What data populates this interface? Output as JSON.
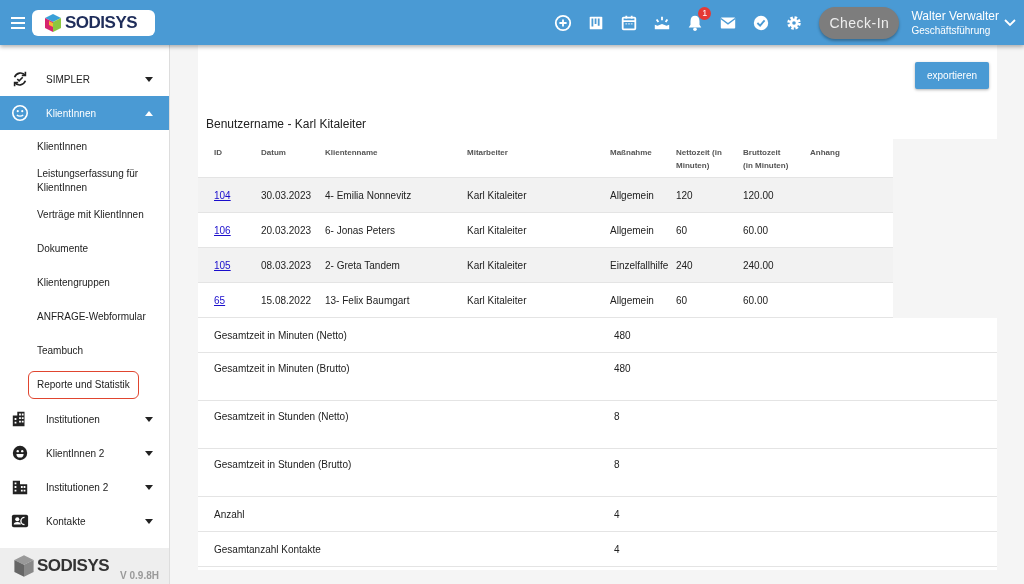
{
  "header": {
    "logo": "SODISYS",
    "notification_count": "1",
    "checkin_button": "Check-In",
    "user": {
      "name": "Walter Verwalter",
      "role": "Geschäftsführung"
    }
  },
  "sidebar": {
    "items": [
      {
        "label": "SIMPLER",
        "selected": false,
        "expanded": false
      },
      {
        "label": "KlientInnen",
        "selected": true,
        "expanded": true,
        "children": [
          {
            "label": "KlientInnen",
            "selected": false
          },
          {
            "label": "Leistungserfassung für KlientInnen",
            "selected": false
          },
          {
            "label": "Verträge mit KlientInnen",
            "selected": false
          },
          {
            "label": "Dokumente",
            "selected": false
          },
          {
            "label": "Klientengruppen",
            "selected": false
          },
          {
            "label": "ANFRAGE-Webformular",
            "selected": false
          },
          {
            "label": "Teambuch",
            "selected": false
          },
          {
            "label": "Reporte und Statistik",
            "selected": true
          }
        ]
      },
      {
        "label": "Institutionen",
        "selected": false,
        "expanded": false
      },
      {
        "label": "KlientInnen 2",
        "selected": false,
        "expanded": false
      },
      {
        "label": "Institutionen 2",
        "selected": false,
        "expanded": false
      },
      {
        "label": "Kontakte",
        "selected": false,
        "expanded": false
      }
    ],
    "footer": {
      "logo": "SODISYS",
      "version": "V 0.9.8H"
    }
  },
  "report": {
    "export_button": "exportieren",
    "title": "Benutzername - Karl Kitaleiter",
    "columns": [
      "ID",
      "Datum",
      "Klientenname",
      "Mitarbeiter",
      "Maßnahme",
      "Nettozeit (in Minuten)",
      "Bruttozeit (in Minuten)",
      "Anhang"
    ],
    "rows": [
      [
        "104",
        "30.03.2023",
        "4- Emilia Nonnevitz",
        "Karl Kitaleiter",
        "Allgemein",
        "120",
        "120.00"
      ],
      [
        "106",
        "20.03.2023",
        "6- Jonas Peters",
        "Karl Kitaleiter",
        "Allgemein",
        "60",
        "60.00"
      ],
      [
        "105",
        "08.03.2023",
        "2- Greta Tandem",
        "Karl Kitaleiter",
        "Einzelfallhilfe",
        "240",
        "240.00"
      ],
      [
        "65",
        "15.08.2022",
        "13- Felix Baumgart",
        "Karl Kitaleiter",
        "Allgemein",
        "60",
        "60.00"
      ]
    ],
    "summary": [
      {
        "label": "Gesamtzeit in Minuten (Netto)",
        "value": "480"
      },
      {
        "label": "Gesamtzeit in Minuten (Brutto)",
        "value": "480"
      },
      {
        "label": "Gesamtzeit in Stunden (Netto)",
        "value": "8"
      },
      {
        "label": "Gesamtzeit in Stunden (Brutto)",
        "value": "8"
      },
      {
        "label": "Anzahl",
        "value": "4"
      },
      {
        "label": "Gesamtanzahl Kontakte",
        "value": "4"
      }
    ]
  }
}
